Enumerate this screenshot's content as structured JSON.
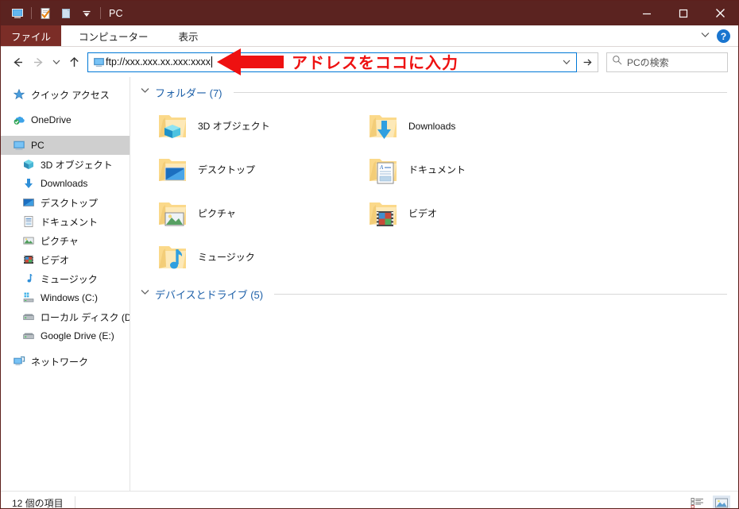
{
  "window": {
    "title": "PC",
    "quick_access": [
      {
        "name": "this-pc-icon",
        "label": "PC"
      },
      {
        "name": "properties-icon",
        "label": "プロパティ"
      },
      {
        "name": "new-folder-icon",
        "label": "新しいフォルダー"
      },
      {
        "name": "customize-quick-access-chevron-icon",
        "label": "クイック アクセス ツール バーのユーザー設定"
      }
    ],
    "controls": {
      "minimize": "最小化",
      "maximize": "最大化",
      "close": "閉じる"
    },
    "titlebar_color": "#5b2320",
    "accent_color": "#0078d7"
  },
  "menubar": {
    "file_tab": "ファイル",
    "tabs": [
      "コンピューター",
      "表示"
    ],
    "collapse_ribbon": "リボンを折りたたむ",
    "help": "?"
  },
  "navbar": {
    "back": "戻る",
    "forward": "進む",
    "recent": "最近表示した場所",
    "up": "上へ",
    "address_value": "ftp://xxx.xxx.xx.xxx:xxxx",
    "address_dropdown": "以前の場所",
    "go_label": "移動",
    "search_placeholder": "PCの検索",
    "search_value": ""
  },
  "annotation": {
    "text": "アドレスをココに入力",
    "color": "#ee1111"
  },
  "sidebar": {
    "items": [
      {
        "label": "クイック アクセス",
        "icon": "star-icon",
        "indent": false,
        "selected": false
      },
      {
        "label": "OneDrive",
        "icon": "onedrive-cloud-icon",
        "indent": false,
        "selected": false
      },
      {
        "label": "PC",
        "icon": "this-pc-icon",
        "indent": false,
        "selected": true
      },
      {
        "label": "3D オブジェクト",
        "icon": "3d-object-icon",
        "indent": true,
        "selected": false
      },
      {
        "label": "Downloads",
        "icon": "downloads-icon",
        "indent": true,
        "selected": false
      },
      {
        "label": "デスクトップ",
        "icon": "desktop-icon",
        "indent": true,
        "selected": false
      },
      {
        "label": "ドキュメント",
        "icon": "documents-icon",
        "indent": true,
        "selected": false
      },
      {
        "label": "ピクチャ",
        "icon": "pictures-icon",
        "indent": true,
        "selected": false
      },
      {
        "label": "ビデオ",
        "icon": "videos-icon",
        "indent": true,
        "selected": false
      },
      {
        "label": "ミュージック",
        "icon": "music-icon",
        "indent": true,
        "selected": false
      },
      {
        "label": "Windows (C:)",
        "icon": "windows-drive-icon",
        "indent": true,
        "selected": false
      },
      {
        "label": "ローカル ディスク (D:)",
        "icon": "local-disk-icon",
        "indent": true,
        "selected": false
      },
      {
        "label": "Google Drive (E:)",
        "icon": "local-disk-icon",
        "indent": true,
        "selected": false
      },
      {
        "label": "ネットワーク",
        "icon": "network-icon",
        "indent": false,
        "selected": false
      }
    ]
  },
  "content": {
    "groups": [
      {
        "title": "フォルダー (7)",
        "expanded": true,
        "items": [
          {
            "label": "3D オブジェクト",
            "icon": "folder-3d-objects"
          },
          {
            "label": "Downloads",
            "icon": "folder-downloads"
          },
          {
            "label": "デスクトップ",
            "icon": "folder-desktop"
          },
          {
            "label": "ドキュメント",
            "icon": "folder-documents"
          },
          {
            "label": "ピクチャ",
            "icon": "folder-pictures"
          },
          {
            "label": "ビデオ",
            "icon": "folder-videos"
          },
          {
            "label": "ミュージック",
            "icon": "folder-music"
          }
        ]
      },
      {
        "title": "デバイスとドライブ (5)",
        "expanded": true,
        "items": []
      }
    ]
  },
  "statusbar": {
    "item_count": "12 個の項目",
    "views": [
      {
        "name": "details-view-button",
        "label": "詳細表示",
        "active": false
      },
      {
        "name": "large-icons-view-button",
        "label": "大アイコン表示",
        "active": true
      }
    ]
  }
}
